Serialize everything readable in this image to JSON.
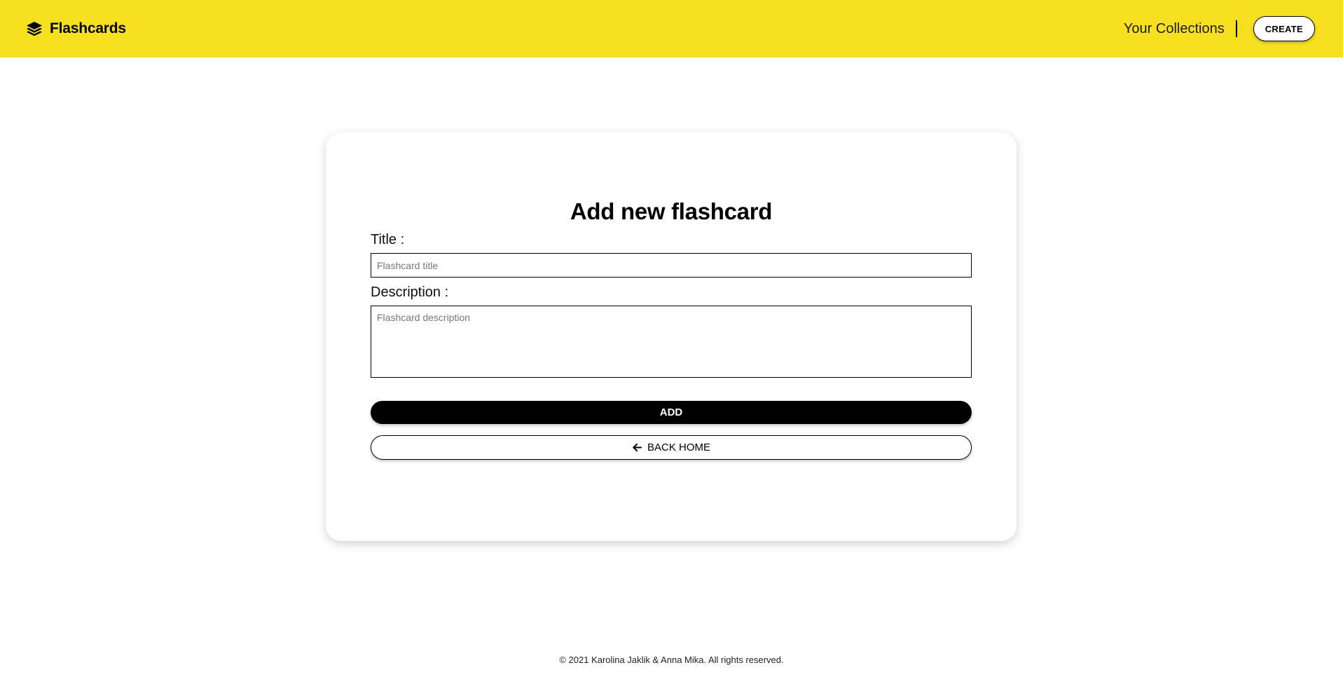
{
  "navbar": {
    "brand_icon": "layers-stack-icon",
    "brand_text": "Flashcards",
    "collections_link": "Your Collections",
    "create_button": "CREATE",
    "background_color": "#f7e01f"
  },
  "form": {
    "title": "Add new flashcard",
    "title_label": "Title :",
    "title_placeholder": "Flashcard title",
    "title_value": "",
    "description_label": "Description :",
    "description_placeholder": "Flashcard description",
    "description_value": "",
    "add_button": "ADD",
    "back_icon": "arrow-left-icon",
    "back_button": "BACK HOME"
  },
  "footer": {
    "text": "© 2021 Karolina Jaklik & Anna Mika. All rights reserved."
  }
}
